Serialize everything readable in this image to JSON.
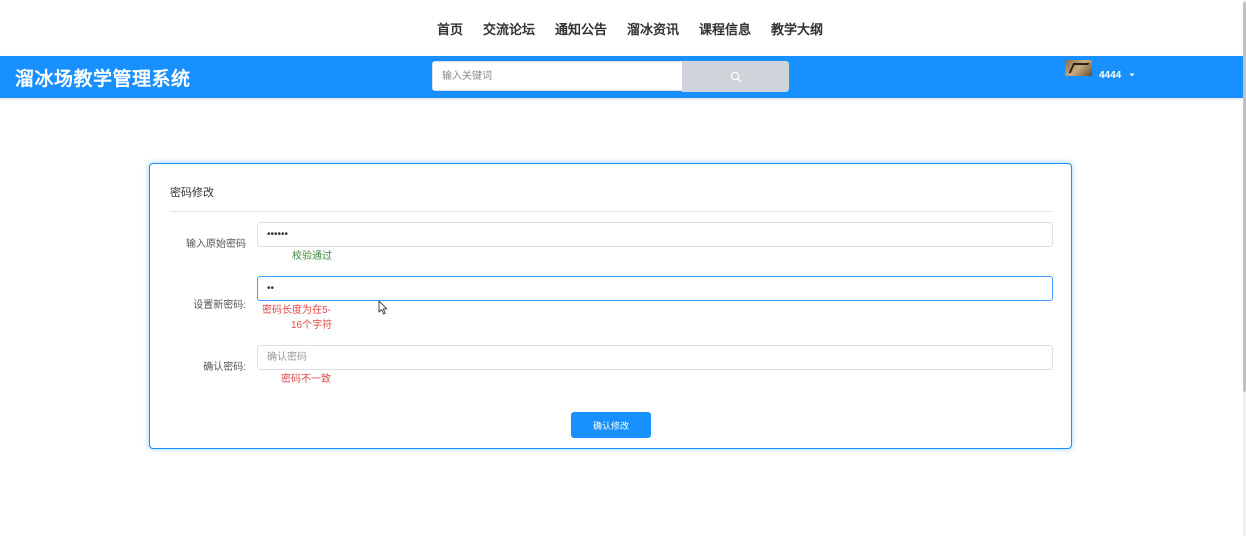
{
  "top_nav": {
    "items": [
      {
        "label": "首页"
      },
      {
        "label": "交流论坛"
      },
      {
        "label": "通知公告"
      },
      {
        "label": "溜冰资讯"
      },
      {
        "label": "课程信息"
      },
      {
        "label": "教学大纲"
      }
    ]
  },
  "header": {
    "brand": "溜冰场教学管理系统",
    "background_color": "#1890ff",
    "search": {
      "placeholder": "输入关键词",
      "value": "",
      "button_icon": "search-icon"
    },
    "user": {
      "username": "4444",
      "caret_icon": "caret-down-icon"
    }
  },
  "form": {
    "title": "密码修改",
    "old_password": {
      "label": "输入原始密码",
      "value": "••••••",
      "message": "校验通过"
    },
    "new_password": {
      "label": "设置新密码:",
      "value": "••",
      "message_line1": "密码长度为在5-",
      "message_line2": "16个字符"
    },
    "confirm_password": {
      "label": "确认密码:",
      "placeholder": "确认密码",
      "message": "密码不一致"
    },
    "submit_label": "确认修改"
  },
  "colors": {
    "accent": "#1890ff",
    "success": "#3a8a3a",
    "error": "#e04848"
  }
}
